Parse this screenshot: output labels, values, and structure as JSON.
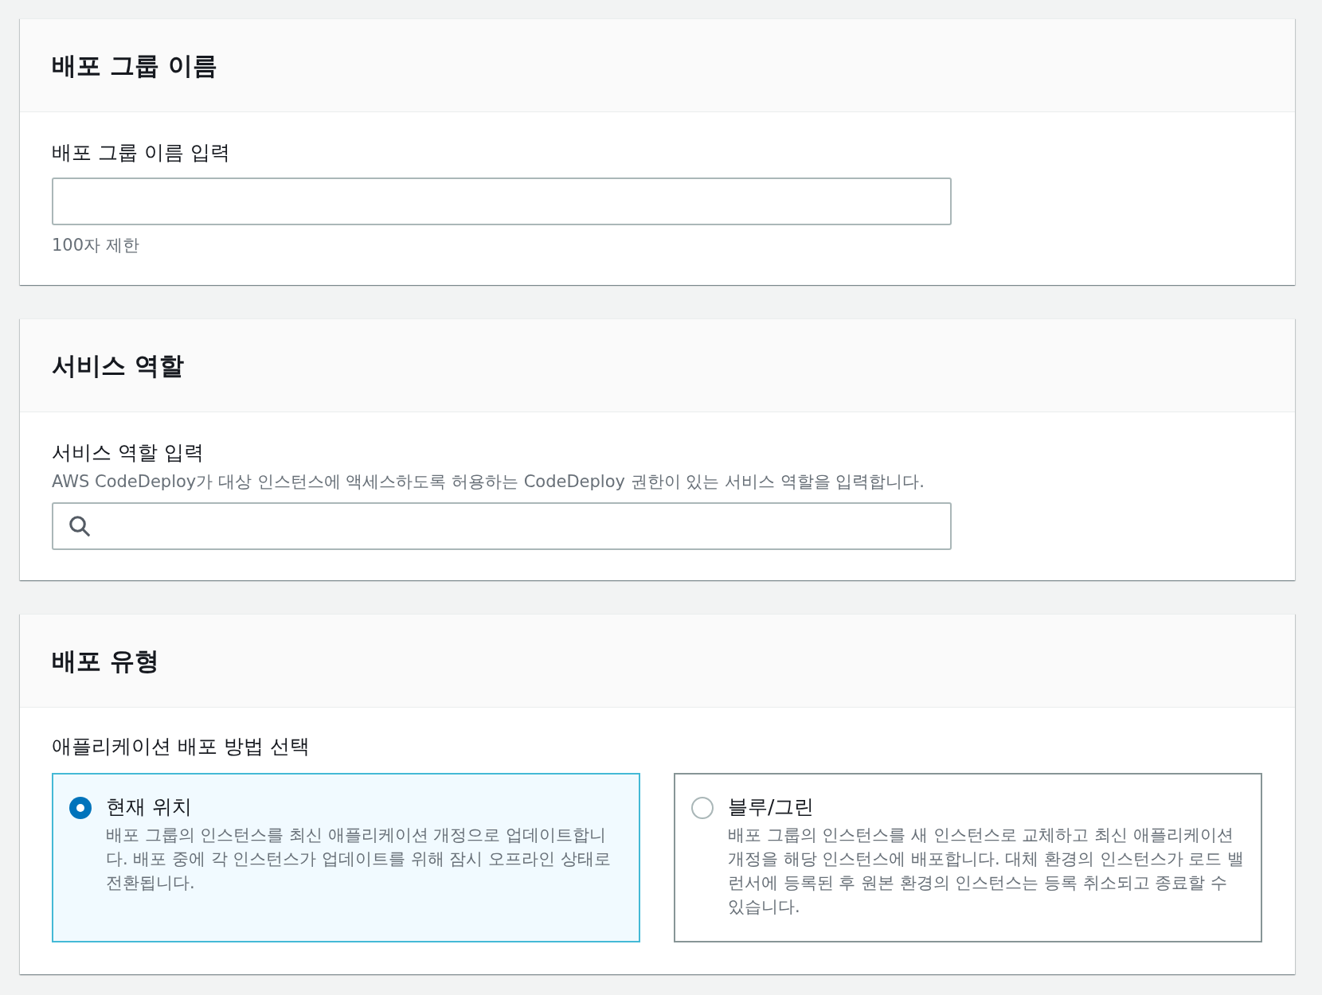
{
  "sections": [
    {
      "kind": "text_field",
      "title": "배포 그룹 이름",
      "label": "배포 그룹 이름 입력",
      "hint": "100자 제한"
    },
    {
      "kind": "search_field",
      "title": "서비스 역할",
      "label": "서비스 역할 입력",
      "description": "AWS CodeDeploy가 대상 인스턴스에 액세스하도록 허용하는 CodeDeploy 권한이 있는 서비스 역할을 입력합니다."
    },
    {
      "kind": "radio_cards",
      "title": "배포 유형",
      "label": "애플리케이션 배포 방법 선택",
      "options": [
        {
          "label": "현재 위치",
          "description": "배포 그룹의 인스턴스를 최신 애플리케이션 개정으로 업데이트합니다. 배포 중에 각 인스턴스가 업데이트를 위해 잠시 오프라인 상태로 전환됩니다.",
          "selected": true
        },
        {
          "label": "블루/그린",
          "description": "배포 그룹의 인스턴스를 새 인스턴스로 교체하고 최신 애플리케이션 개정을 해당 인스턴스에 배포합니다. 대체 환경의 인스턴스가 로드 밸런서에 등록된 후 원본 환경의 인스턴스는 등록 취소되고 종료할 수 있습니다.",
          "selected": false
        }
      ]
    }
  ]
}
